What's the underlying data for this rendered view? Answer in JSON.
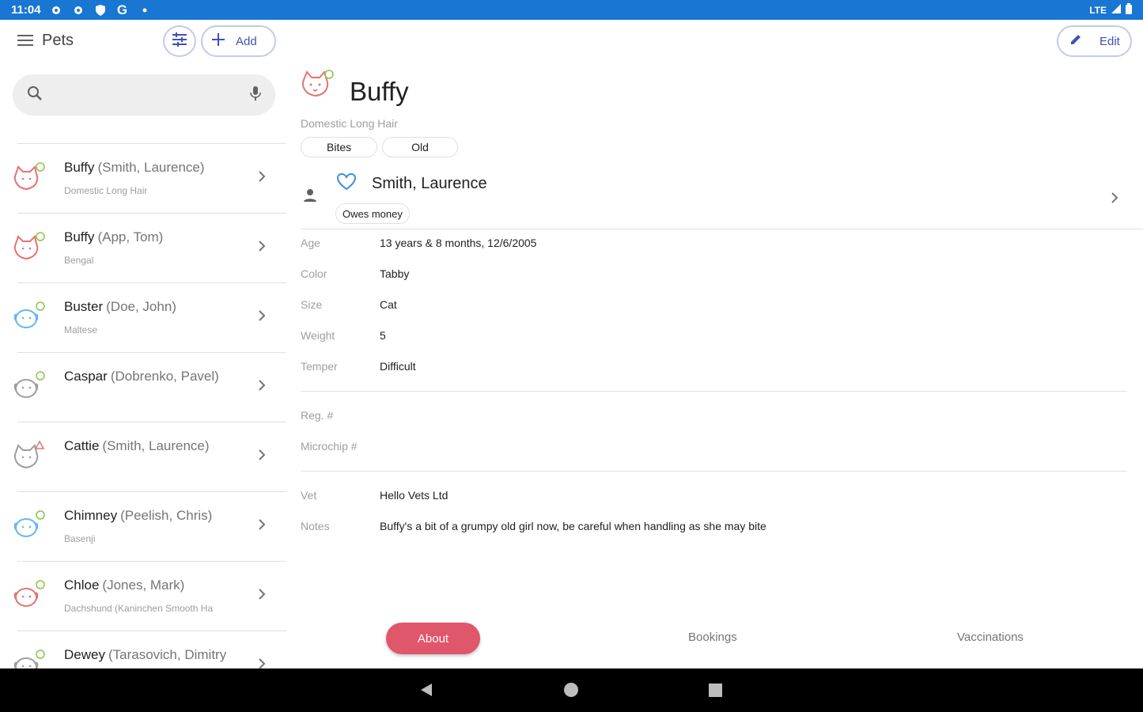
{
  "status_bar": {
    "time": "11:04",
    "network": "LTE"
  },
  "header": {
    "title": "Pets",
    "add_label": "Add",
    "edit_label": "Edit"
  },
  "search": {
    "placeholder": ""
  },
  "pets": [
    {
      "name": "Buffy",
      "owner": "(Smith, Laurence)",
      "breed": "Domestic Long Hair",
      "icon": "cat-icon",
      "color": "#e57373",
      "badge": "green"
    },
    {
      "name": "Buffy",
      "owner": "(App, Tom)",
      "breed": "Bengal",
      "icon": "cat-icon",
      "color": "#e57373",
      "badge": "green"
    },
    {
      "name": "Buster",
      "owner": "(Doe, John)",
      "breed": "Maltese",
      "icon": "dog-icon",
      "color": "#64b5f6",
      "badge": "green"
    },
    {
      "name": "Caspar",
      "owner": "(Dobrenko, Pavel)",
      "breed": "",
      "icon": "dog-icon",
      "color": "#9e9e9e",
      "badge": "green"
    },
    {
      "name": "Cattie",
      "owner": "(Smith, Laurence)",
      "breed": "",
      "icon": "cat-icon",
      "color": "#9e9e9e",
      "badge": "red"
    },
    {
      "name": "Chimney",
      "owner": "(Peelish, Chris)",
      "breed": "Basenji",
      "icon": "dog-icon",
      "color": "#64b5f6",
      "badge": "green"
    },
    {
      "name": "Chloe",
      "owner": "(Jones, Mark)",
      "breed": "Dachshund (Kaninchen Smooth Ha",
      "icon": "dog-icon",
      "color": "#e57373",
      "badge": "green"
    },
    {
      "name": "Dewey",
      "owner": "(Tarasovich, Dimitry",
      "breed": "",
      "icon": "dog-icon",
      "color": "#9e9e9e",
      "badge": "green"
    }
  ],
  "detail": {
    "name": "Buffy",
    "breed": "Domestic Long Hair",
    "tags": [
      "Bites",
      "Old"
    ],
    "owner": "Smith, Laurence",
    "owner_tag": "Owes money",
    "fields": [
      {
        "key": "Age",
        "value": "13 years & 8 months, 12/6/2005"
      },
      {
        "key": "Color",
        "value": "Tabby"
      },
      {
        "key": "Size",
        "value": "Cat"
      },
      {
        "key": "Weight",
        "value": "5"
      },
      {
        "key": "Temper",
        "value": "Difficult"
      }
    ],
    "ids": [
      {
        "key": "Reg. #",
        "value": ""
      },
      {
        "key": "Microchip #",
        "value": ""
      }
    ],
    "extra": [
      {
        "key": "Vet",
        "value": "Hello Vets Ltd"
      },
      {
        "key": "Notes",
        "value": "Buffy's a bit of a grumpy old girl now, be careful when handling as she may bite"
      }
    ]
  },
  "tabs": {
    "about": "About",
    "bookings": "Bookings",
    "vaccinations": "Vaccinations"
  },
  "colors": {
    "status_bar": "#1976d2",
    "accent": "#3f51b5",
    "tab_active": "#e0566a"
  }
}
